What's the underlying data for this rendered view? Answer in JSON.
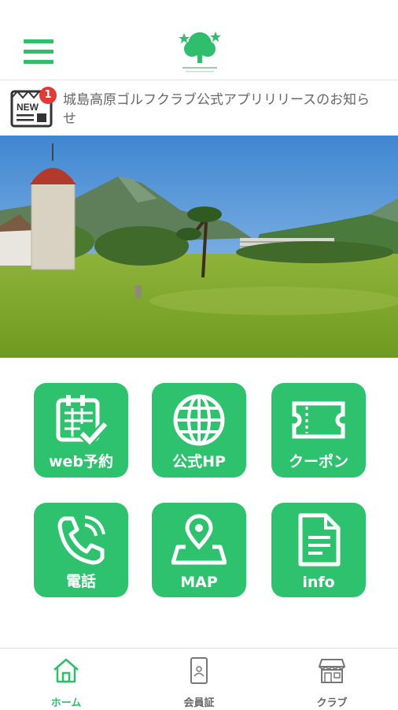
{
  "header": {
    "menu_icon": "hamburger-menu-icon",
    "logo_icon": "tree-logo-icon"
  },
  "news": {
    "icon": "newspaper-icon",
    "icon_text": "NEW",
    "badge_count": "1",
    "text": "城島高原ゴルフクラブ公式アプリリリースのお知らせ"
  },
  "hero": {
    "description_icon": "golf-course-photo"
  },
  "menu": [
    {
      "label": "web予約",
      "icon": "calendar-check-icon"
    },
    {
      "label": "公式HP",
      "icon": "globe-icon"
    },
    {
      "label": "クーポン",
      "icon": "ticket-icon"
    },
    {
      "label": "電話",
      "icon": "phone-icon"
    },
    {
      "label": "MAP",
      "icon": "map-pin-icon"
    },
    {
      "label": "info",
      "icon": "document-icon"
    }
  ],
  "tabs": [
    {
      "label": "ホーム",
      "icon": "home-icon",
      "active": true
    },
    {
      "label": "会員証",
      "icon": "member-card-icon",
      "active": false
    },
    {
      "label": "クラブ",
      "icon": "store-icon",
      "active": false
    }
  ],
  "colors": {
    "accent": "#2fbe6b",
    "tile": "#2ec26e",
    "badge": "#e53935"
  }
}
